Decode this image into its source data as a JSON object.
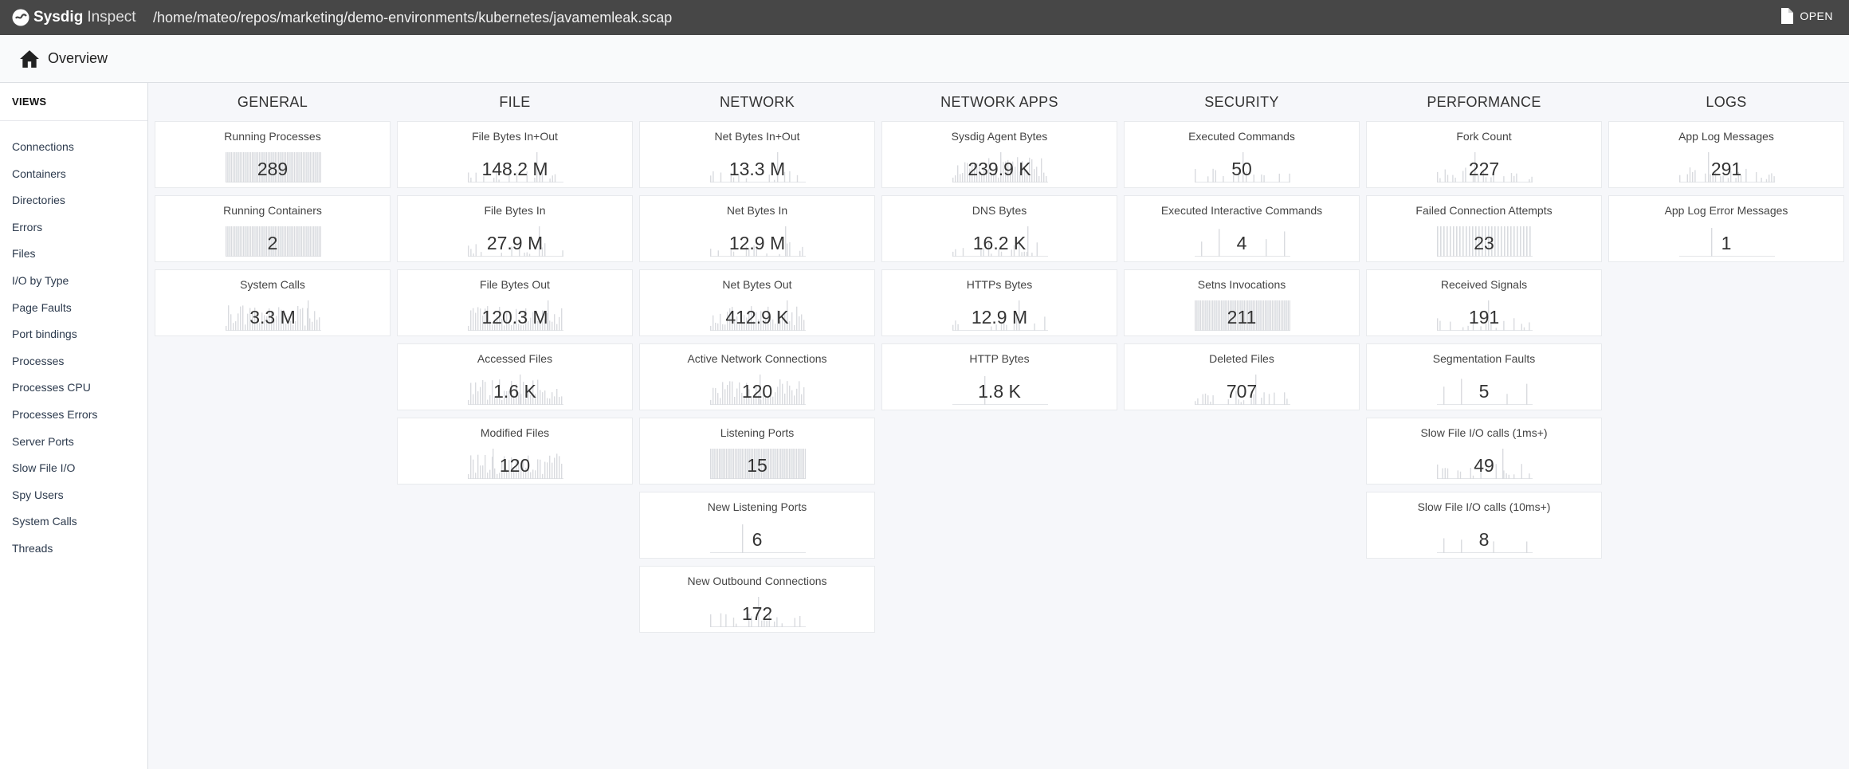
{
  "app": {
    "name_bold": "Sysdig",
    "name_light": "Inspect",
    "file_path": "/home/mateo/repos/marketing/demo-environments/kubernetes/javamemleak.scap",
    "open_label": "OPEN"
  },
  "subheader": {
    "title": "Overview"
  },
  "sidebar": {
    "header": "VIEWS",
    "items": [
      "Connections",
      "Containers",
      "Directories",
      "Errors",
      "Files",
      "I/O by Type",
      "Page Faults",
      "Port bindings",
      "Processes",
      "Processes CPU",
      "Processes Errors",
      "Server Ports",
      "Slow File I/O",
      "Spy Users",
      "System Calls",
      "Threads"
    ]
  },
  "colors": {
    "topbar": "#474747",
    "sparkline": "#d9dbdf"
  },
  "columns": [
    {
      "header": "GENERAL",
      "tiles": [
        {
          "title": "Running Processes",
          "value": "289",
          "spark": "full"
        },
        {
          "title": "Running Containers",
          "value": "2",
          "spark": "full"
        },
        {
          "title": "System Calls",
          "value": "3.3 M",
          "spark": "dense"
        }
      ]
    },
    {
      "header": "FILE",
      "tiles": [
        {
          "title": "File Bytes In+Out",
          "value": "148.2 M",
          "spark": "sparse"
        },
        {
          "title": "File Bytes In",
          "value": "27.9 M",
          "spark": "sparse"
        },
        {
          "title": "File Bytes Out",
          "value": "120.3 M",
          "spark": "dense"
        },
        {
          "title": "Accessed Files",
          "value": "1.6 K",
          "spark": "dense"
        },
        {
          "title": "Modified Files",
          "value": "120",
          "spark": "dense"
        }
      ]
    },
    {
      "header": "NETWORK",
      "tiles": [
        {
          "title": "Net Bytes In+Out",
          "value": "13.3 M",
          "spark": "sparse"
        },
        {
          "title": "Net Bytes In",
          "value": "12.9 M",
          "spark": "sparse"
        },
        {
          "title": "Net Bytes Out",
          "value": "412.9 K",
          "spark": "dense"
        },
        {
          "title": "Active Network Connections",
          "value": "120",
          "spark": "dense"
        },
        {
          "title": "Listening Ports",
          "value": "15",
          "spark": "full"
        },
        {
          "title": "New Listening Ports",
          "value": "6",
          "spark": "single"
        },
        {
          "title": "New Outbound Connections",
          "value": "172",
          "spark": "sparse"
        }
      ]
    },
    {
      "header": "NETWORK APPS",
      "tiles": [
        {
          "title": "Sysdig Agent Bytes",
          "value": "239.9 K",
          "spark": "dense"
        },
        {
          "title": "DNS Bytes",
          "value": "16.2 K",
          "spark": "sparse"
        },
        {
          "title": "HTTPs Bytes",
          "value": "12.9 M",
          "spark": "sparse"
        },
        {
          "title": "HTTP Bytes",
          "value": "1.8 K",
          "spark": "single"
        }
      ]
    },
    {
      "header": "SECURITY",
      "tiles": [
        {
          "title": "Executed Commands",
          "value": "50",
          "spark": "sparse"
        },
        {
          "title": "Executed Interactive Commands",
          "value": "4",
          "spark": "few"
        },
        {
          "title": "Setns Invocations",
          "value": "211",
          "spark": "full"
        },
        {
          "title": "Deleted Files",
          "value": "707",
          "spark": "sparse"
        }
      ]
    },
    {
      "header": "PERFORMANCE",
      "tiles": [
        {
          "title": "Fork Count",
          "value": "227",
          "spark": "sparse"
        },
        {
          "title": "Failed Connection Attempts",
          "value": "23",
          "spark": "stripes"
        },
        {
          "title": "Received Signals",
          "value": "191",
          "spark": "sparse"
        },
        {
          "title": "Segmentation Faults",
          "value": "5",
          "spark": "few"
        },
        {
          "title": "Slow File I/O calls (1ms+)",
          "value": "49",
          "spark": "sparse"
        },
        {
          "title": "Slow File I/O calls (10ms+)",
          "value": "8",
          "spark": "few"
        }
      ]
    },
    {
      "header": "LOGS",
      "tiles": [
        {
          "title": "App Log Messages",
          "value": "291",
          "spark": "sparse"
        },
        {
          "title": "App Log Error Messages",
          "value": "1",
          "spark": "single"
        }
      ]
    }
  ]
}
